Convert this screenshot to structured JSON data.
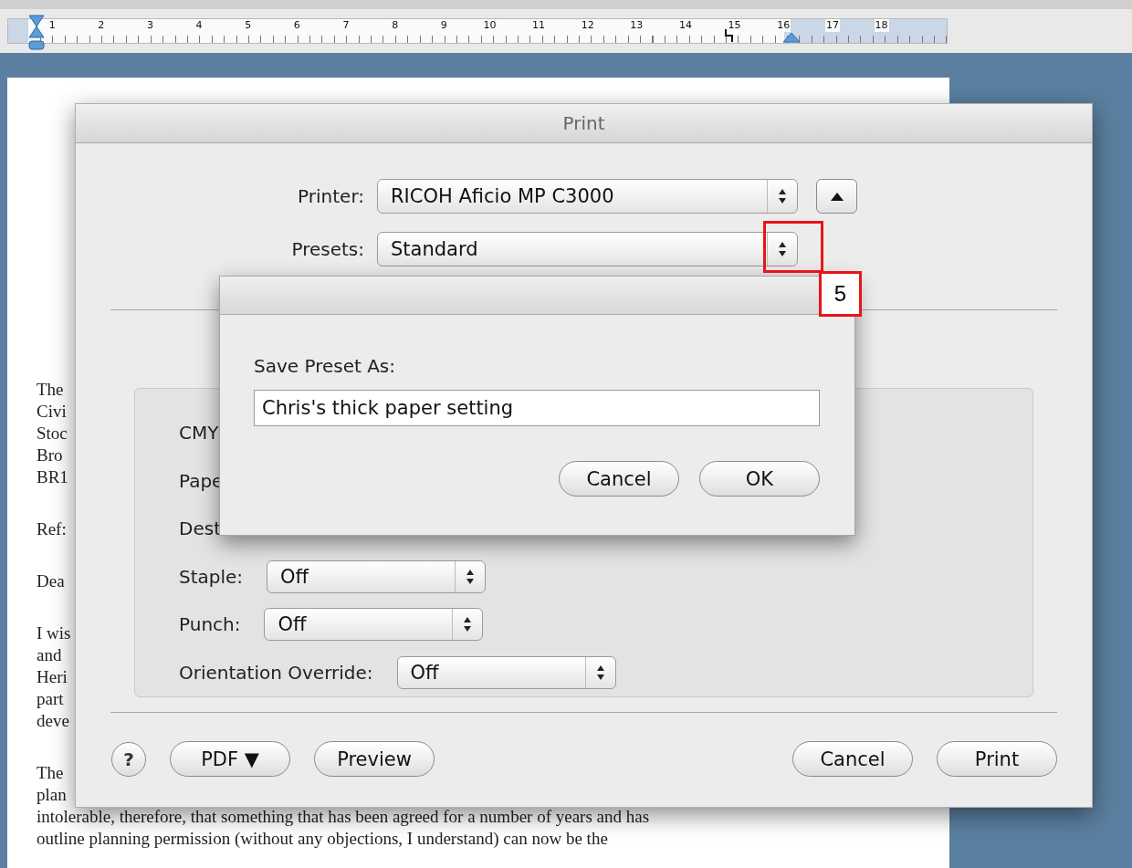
{
  "ruler": {
    "numbers": [
      "1",
      "2",
      "3",
      "4",
      "5",
      "6",
      "7",
      "8",
      "9",
      "10",
      "11",
      "12",
      "13",
      "14",
      "15",
      "16",
      "17",
      "18"
    ]
  },
  "document": {
    "paragraphs": [
      [
        "The",
        "Civi",
        "Stoc",
        "Bro",
        "BR1"
      ],
      [
        "Ref:"
      ],
      [
        "Dea"
      ],
      [
        "I wis",
        "and",
        "Heri",
        "part",
        "deve"
      ],
      [
        "The",
        "plan",
        "intolerable, therefore, that something that has been agreed for a number of years and has",
        "outline planning permission (without any objections, I understand) can now be the"
      ]
    ]
  },
  "print_dialog": {
    "title": "Print",
    "printer": {
      "label": "Printer:",
      "value": "RICOH Aficio MP C3000"
    },
    "presets": {
      "label": "Presets:",
      "value": "Standard"
    },
    "options": [
      {
        "kind": "label",
        "label": "CMY"
      },
      {
        "kind": "label",
        "label": "Pape"
      },
      {
        "kind": "label",
        "label": "Dest"
      },
      {
        "kind": "popup",
        "label": "Staple:",
        "value": "Off"
      },
      {
        "kind": "popup",
        "label": "Punch:",
        "value": "Off"
      },
      {
        "kind": "popup",
        "label": "Orientation Override:",
        "value": "Off"
      }
    ],
    "left_buttons": [
      {
        "kind": "help",
        "label": "?"
      },
      {
        "kind": "push",
        "label": "PDF ▼"
      },
      {
        "kind": "push",
        "label": "Preview"
      }
    ],
    "right_buttons": [
      {
        "kind": "push",
        "label": "Cancel"
      },
      {
        "kind": "push",
        "label": "Print"
      }
    ]
  },
  "save_sheet": {
    "prompt": "Save Preset As:",
    "value": "Chris's thick paper setting",
    "buttons": [
      "Cancel",
      "OK"
    ]
  },
  "callout": {
    "label": "5"
  }
}
